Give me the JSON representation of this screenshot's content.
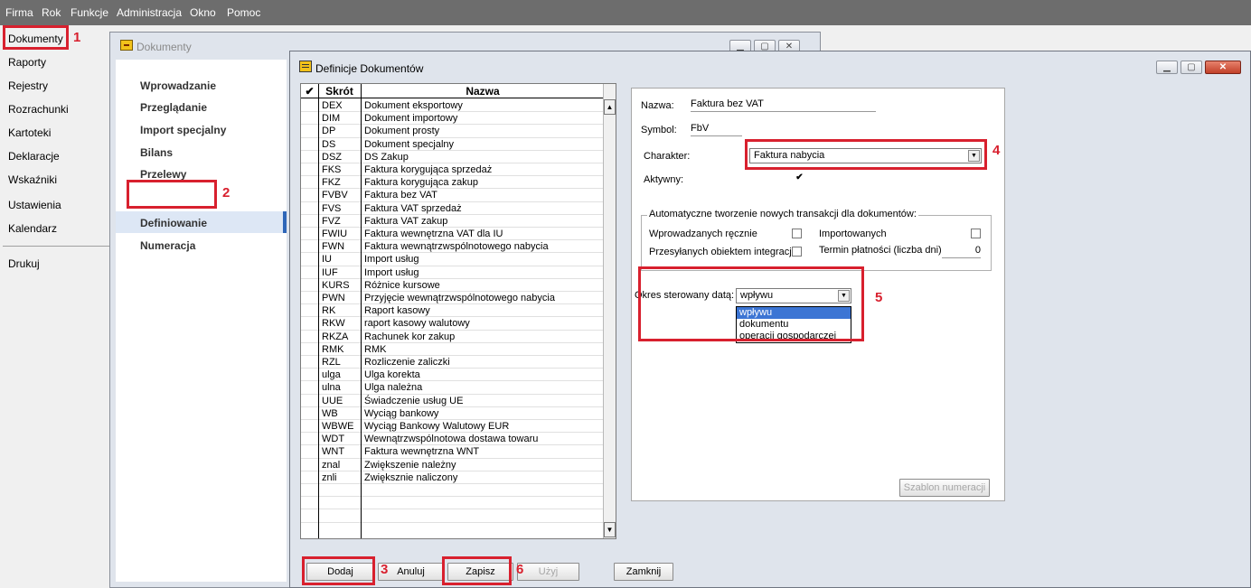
{
  "menubar": {
    "items": [
      "Firma",
      "Rok",
      "Funkcje",
      "Administracja",
      "Okno",
      "Pomoc"
    ]
  },
  "leftnav": {
    "items": [
      "Dokumenty",
      "Raporty",
      "Rejestry",
      "Rozrachunki",
      "Kartoteki",
      "Deklaracje",
      "Wskaźniki",
      "Ustawienia",
      "Kalendarz"
    ],
    "print": "Drukuj"
  },
  "annotations": [
    "1",
    "2",
    "3",
    "4",
    "5",
    "6"
  ],
  "win1": {
    "title": "Dokumenty",
    "items": [
      "Wprowadzanie",
      "Przeglądanie",
      "Import specjalny",
      "Bilans",
      "Przelewy",
      "Definiowanie",
      "Numeracja"
    ]
  },
  "win2": {
    "title": "Definicje Dokumentów",
    "grid": {
      "headers": {
        "check": "✔",
        "code": "Skrót",
        "name": "Nazwa"
      },
      "rows": [
        [
          "DEX",
          "Dokument eksportowy"
        ],
        [
          "DIM",
          "Dokument importowy"
        ],
        [
          "DP",
          "Dokument prosty"
        ],
        [
          "DS",
          "Dokument specjalny"
        ],
        [
          "DSZ",
          "DS Zakup"
        ],
        [
          "FKS",
          "Faktura korygująca sprzedaż"
        ],
        [
          "FKZ",
          "Faktura korygująca zakup"
        ],
        [
          "FVBV",
          "Faktura bez VAT"
        ],
        [
          "FVS",
          "Faktura VAT sprzedaż"
        ],
        [
          "FVZ",
          "Faktura VAT zakup"
        ],
        [
          "FWIU",
          "Faktura wewnętrzna VAT dla IU"
        ],
        [
          "FWN",
          "Faktura wewnątrzwspólnotowego nabycia"
        ],
        [
          "IU",
          "Import usług"
        ],
        [
          "IUF",
          "Import usług"
        ],
        [
          "KURS",
          "Różnice kursowe"
        ],
        [
          "PWN",
          "Przyjęcie wewnątrzwspólnotowego nabycia"
        ],
        [
          "RK",
          "Raport kasowy"
        ],
        [
          "RKW",
          "raport kasowy walutowy"
        ],
        [
          "RKZA",
          "Rachunek kor zakup"
        ],
        [
          "RMK",
          "RMK"
        ],
        [
          "RZL",
          "Rozliczenie zaliczki"
        ],
        [
          "ulga",
          "Ulga korekta"
        ],
        [
          "ulna",
          "Ulga należna"
        ],
        [
          "UUE",
          "Świadczenie usług UE"
        ],
        [
          "WB",
          "Wyciąg bankowy"
        ],
        [
          "WBWE",
          "Wyciąg Bankowy Walutowy EUR"
        ],
        [
          "WDT",
          "Wewnątrzwspólnotowa dostawa towaru"
        ],
        [
          "WNT",
          "Faktura wewnętrzna WNT"
        ],
        [
          "znal",
          "Zwiększenie należny"
        ],
        [
          "znli",
          "Zwiększnie naliczony"
        ]
      ]
    },
    "detail": {
      "name_label": "Nazwa:",
      "name_value": "Faktura bez VAT",
      "symbol_label": "Symbol:",
      "symbol_value": "FbV",
      "charakter_label": "Charakter:",
      "charakter_value": "Faktura nabycia",
      "aktywny_label": "Aktywny:",
      "group_title": "Automatyczne tworzenie nowych transakcji dla dokumentów:",
      "manual_label": "Wprowadzanych ręcznie",
      "imported_label": "Importowanych",
      "integration_label": "Przesyłanych obiektem integracji",
      "term_label": "Termin płatności (liczba dni)",
      "term_value": "0",
      "okres_label": "Okres sterowany datą:",
      "okres_value": "wpływu",
      "okres_options": [
        "wpływu",
        "dokumentu",
        "operacji gospodarczej"
      ],
      "szablon_button": "Szablon numeracji"
    },
    "buttons": {
      "dodaj": "Dodaj",
      "anuluj": "Anuluj",
      "zapisz": "Zapisz",
      "uzyj": "Użyj",
      "zamknij": "Zamknij"
    }
  }
}
